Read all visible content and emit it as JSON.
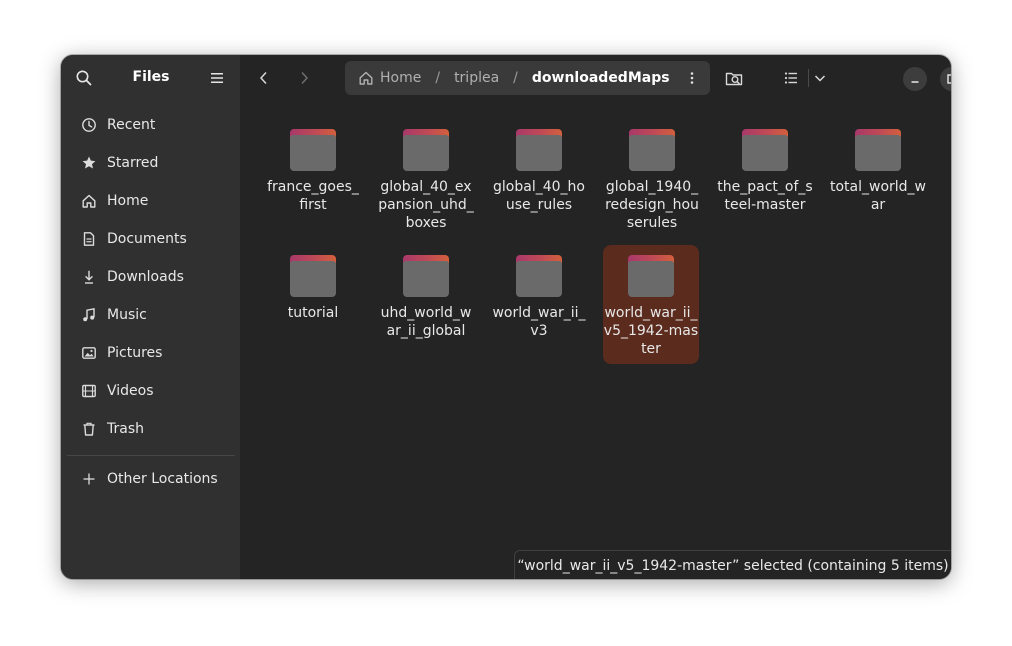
{
  "sidebar": {
    "title": "Files",
    "items": [
      {
        "label": "Recent",
        "icon": "clock-icon"
      },
      {
        "label": "Starred",
        "icon": "star-icon"
      },
      {
        "label": "Home",
        "icon": "home-icon"
      },
      {
        "label": "Documents",
        "icon": "document-icon"
      },
      {
        "label": "Downloads",
        "icon": "download-icon"
      },
      {
        "label": "Music",
        "icon": "music-icon"
      },
      {
        "label": "Pictures",
        "icon": "picture-icon"
      },
      {
        "label": "Videos",
        "icon": "video-icon"
      },
      {
        "label": "Trash",
        "icon": "trash-icon"
      }
    ],
    "other_locations": "Other Locations"
  },
  "path": {
    "home": "Home",
    "folder1": "triplea",
    "current": "downloadedMaps",
    "separator": "/"
  },
  "folders": [
    {
      "name": "france_goes_first"
    },
    {
      "name": "global_40_expansion_uhd_boxes"
    },
    {
      "name": "global_40_house_rules"
    },
    {
      "name": "global_1940_redesign_houserules"
    },
    {
      "name": "the_pact_of_steel-master"
    },
    {
      "name": "total_world_war"
    },
    {
      "name": "tutorial"
    },
    {
      "name": "uhd_world_war_ii_global"
    },
    {
      "name": "world_war_ii_v3"
    },
    {
      "name": "world_war_ii_v5_1942-master"
    }
  ],
  "selected_folder": "world_war_ii_v5_1942-master",
  "status": "“world_war_ii_v5_1942-master” selected  (containing 5 items)",
  "colors": {
    "sidebar_bg": "#303030",
    "content_bg": "#242424",
    "selection_bg": "#5b2b1d",
    "folder_accent": "#c04a55"
  }
}
